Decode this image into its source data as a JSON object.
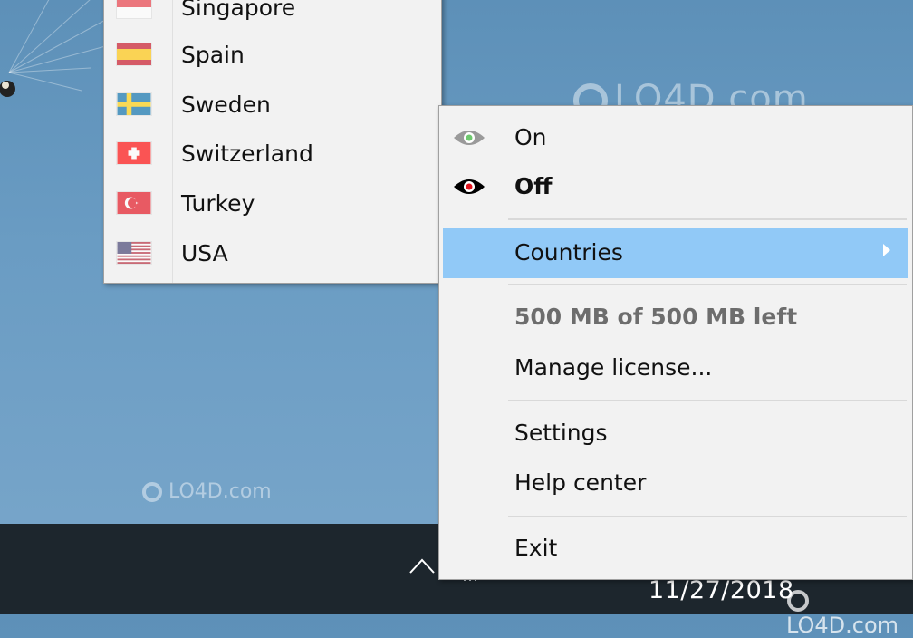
{
  "desktop": {
    "watermark_text": "LO4D.com"
  },
  "submenu": {
    "items": [
      {
        "label": "Singapore",
        "flag": "singapore-flag"
      },
      {
        "label": "Spain",
        "flag": "spain-flag"
      },
      {
        "label": "Sweden",
        "flag": "sweden-flag"
      },
      {
        "label": "Switzerland",
        "flag": "switzerland-flag"
      },
      {
        "label": "Turkey",
        "flag": "turkey-flag"
      },
      {
        "label": "USA",
        "flag": "usa-flag"
      }
    ]
  },
  "mainmenu": {
    "on_label": "On",
    "off_label": "Off",
    "countries_label": "Countries",
    "data_left_label": "500 MB of 500 MB left",
    "manage_license_label": "Manage license...",
    "settings_label": "Settings",
    "help_center_label": "Help center",
    "exit_label": "Exit"
  },
  "taskbar": {
    "date": "11/27/2018",
    "tray_dots": "…"
  },
  "colors": {
    "highlight": "#91c9f7",
    "menu_bg": "#f2f2f2",
    "taskbar_bg": "#1d262d",
    "eye_on": "#6fc96f",
    "eye_off": "#e0141e"
  }
}
